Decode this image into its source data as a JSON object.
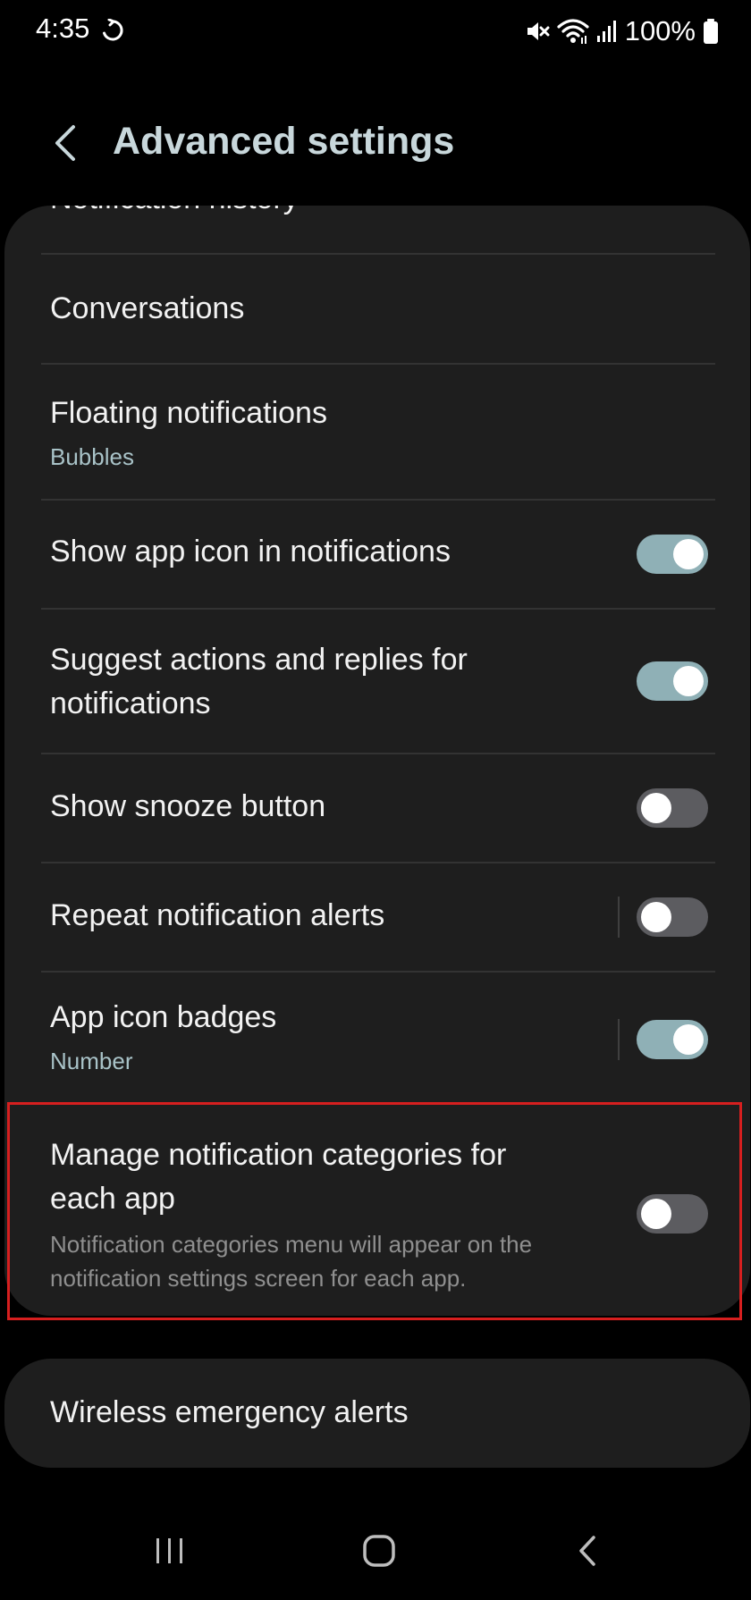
{
  "status_bar": {
    "time": "4:35",
    "battery": "100%",
    "icons": [
      "sync-icon",
      "mute-icon",
      "wifi-icon",
      "signal-icon",
      "battery-icon"
    ]
  },
  "header": {
    "title": "Advanced settings",
    "back_icon": "chevron-left-icon"
  },
  "settings": {
    "partial_item": "Notification history",
    "conversations": {
      "title": "Conversations"
    },
    "floating": {
      "title": "Floating notifications",
      "subtitle": "Bubbles"
    },
    "show_app_icon": {
      "title": "Show app icon in notifications",
      "enabled": true
    },
    "suggest_actions": {
      "title_line1": "Suggest actions and replies for",
      "title_line2": "notifications",
      "enabled": true
    },
    "snooze": {
      "title": "Show snooze button",
      "enabled": false
    },
    "repeat": {
      "title": "Repeat notification alerts",
      "enabled": false
    },
    "badges": {
      "title": "App icon badges",
      "subtitle": "Number",
      "enabled": true
    },
    "categories": {
      "title_line1": "Manage notification categories for",
      "title_line2": "each app",
      "description": "Notification categories menu will appear on the notification settings screen for each app.",
      "enabled": false
    }
  },
  "emergency": {
    "title": "Wireless emergency alerts"
  },
  "colors": {
    "accent": "#8fb0b6",
    "title": "#c8d7db",
    "highlight": "#d61f1f",
    "card": "#1e1e1e"
  },
  "navbar": {
    "icons": [
      "recent-apps-icon",
      "home-icon",
      "back-icon"
    ]
  }
}
